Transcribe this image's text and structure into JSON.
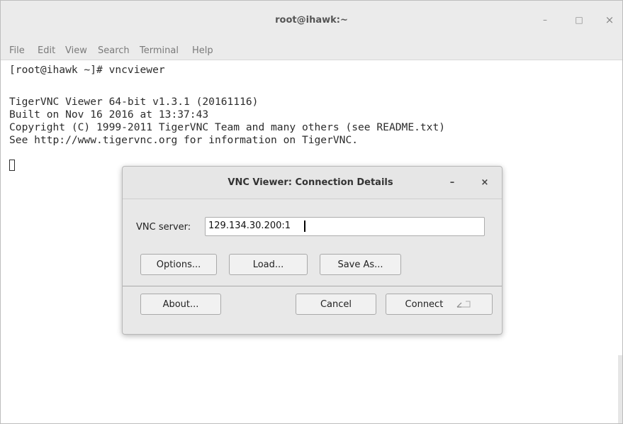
{
  "window": {
    "title": "root@ihawk:~",
    "controls": {
      "minimize": "–",
      "maximize": "□",
      "close": "×"
    }
  },
  "menu": {
    "items": [
      "File",
      "Edit",
      "View",
      "Search",
      "Terminal",
      "Help"
    ]
  },
  "terminal": {
    "lines": [
      "[root@ihawk ~]# vncviewer",
      "",
      "TigerVNC Viewer 64-bit v1.3.1 (20161116)",
      "Built on Nov 16 2016 at 13:37:43",
      "Copyright (C) 1999-2011 TigerVNC Team and many others (see README.txt)",
      "See http://www.tigervnc.org for information on TigerVNC."
    ]
  },
  "dialog": {
    "title": "VNC Viewer: Connection Details",
    "minimize": "–",
    "close": "×",
    "server_label": "VNC server:",
    "server_value": "129.134.30.200:1",
    "buttons": {
      "options": "Options...",
      "load": "Load...",
      "save_as": "Save As...",
      "about": "About...",
      "cancel": "Cancel",
      "connect": "Connect"
    },
    "connect_icon": "enter-key-icon"
  }
}
